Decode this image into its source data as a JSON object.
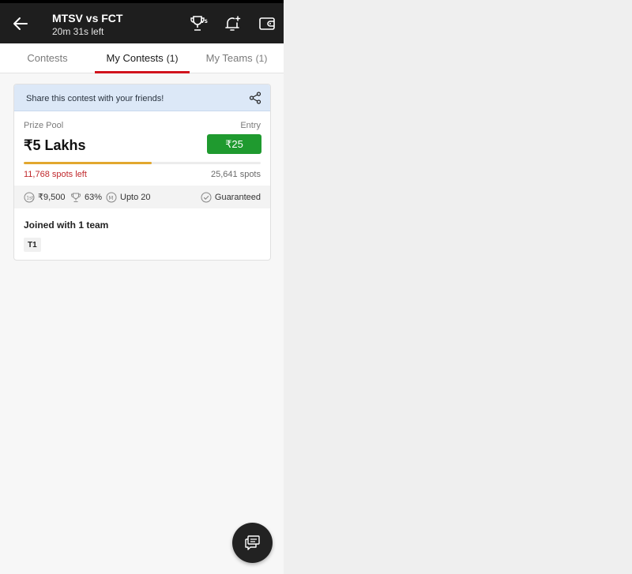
{
  "header": {
    "title": "MTSV vs FCT",
    "subtitle": "20m 31s left",
    "icons": [
      "back-arrow-icon",
      "trophy-vs-icon",
      "bell-plus-icon",
      "wallet-icon"
    ]
  },
  "tabs": [
    {
      "label": "Contests",
      "count": ""
    },
    {
      "label": "My Contests",
      "count": "(1)"
    },
    {
      "label": "My Teams",
      "count": "(1)"
    }
  ],
  "active_tab": "My Contests",
  "contest": {
    "share_text": "Share this contest with your friends!",
    "prize_label": "Prize Pool",
    "prize_value": "₹5 Lakhs",
    "entry_label": "Entry",
    "entry_fee": "₹25",
    "spots_left": "11,768 spots left",
    "spots_total": "25,641 spots",
    "fill_fraction": 0.54,
    "stats": {
      "first_prize": "₹9,500",
      "win_percent": "63%",
      "max_entries": "Upto 20",
      "guaranteed": "Guaranteed"
    },
    "joined_text": "Joined with 1 team",
    "team_chip": "T1"
  },
  "colors": {
    "header_bg": "#1e1e1e",
    "accent_red": "#d1131d",
    "entry_green": "#1f9a2f",
    "progress_gold": "#e2a72e",
    "share_bg": "#dce8f7",
    "spots_left_red": "#c0282c"
  }
}
